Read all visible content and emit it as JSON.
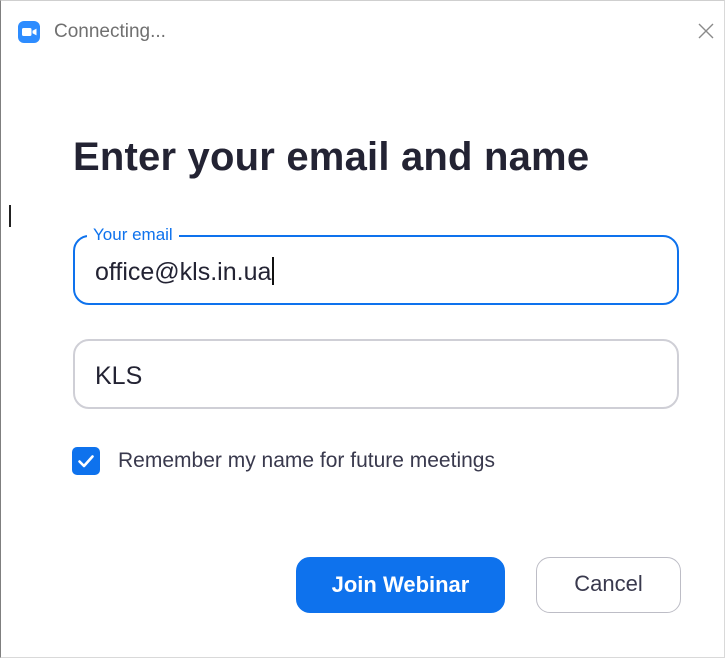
{
  "window": {
    "title": "Connecting...",
    "icons": {
      "app": "zoom-camera-icon",
      "close": "close-icon",
      "checkbox": "checkmark-icon"
    }
  },
  "form": {
    "heading": "Enter your email and name",
    "email": {
      "label": "Your email",
      "value": "office@kls.in.ua"
    },
    "name": {
      "value": "KLS"
    },
    "remember": {
      "label": "Remember my name for future meetings",
      "checked": true
    }
  },
  "actions": {
    "join_label": "Join Webinar",
    "cancel_label": "Cancel"
  },
  "colors": {
    "accent": "#0e72ed",
    "app_icon": "#2d8cff",
    "heading_text": "#232333"
  }
}
